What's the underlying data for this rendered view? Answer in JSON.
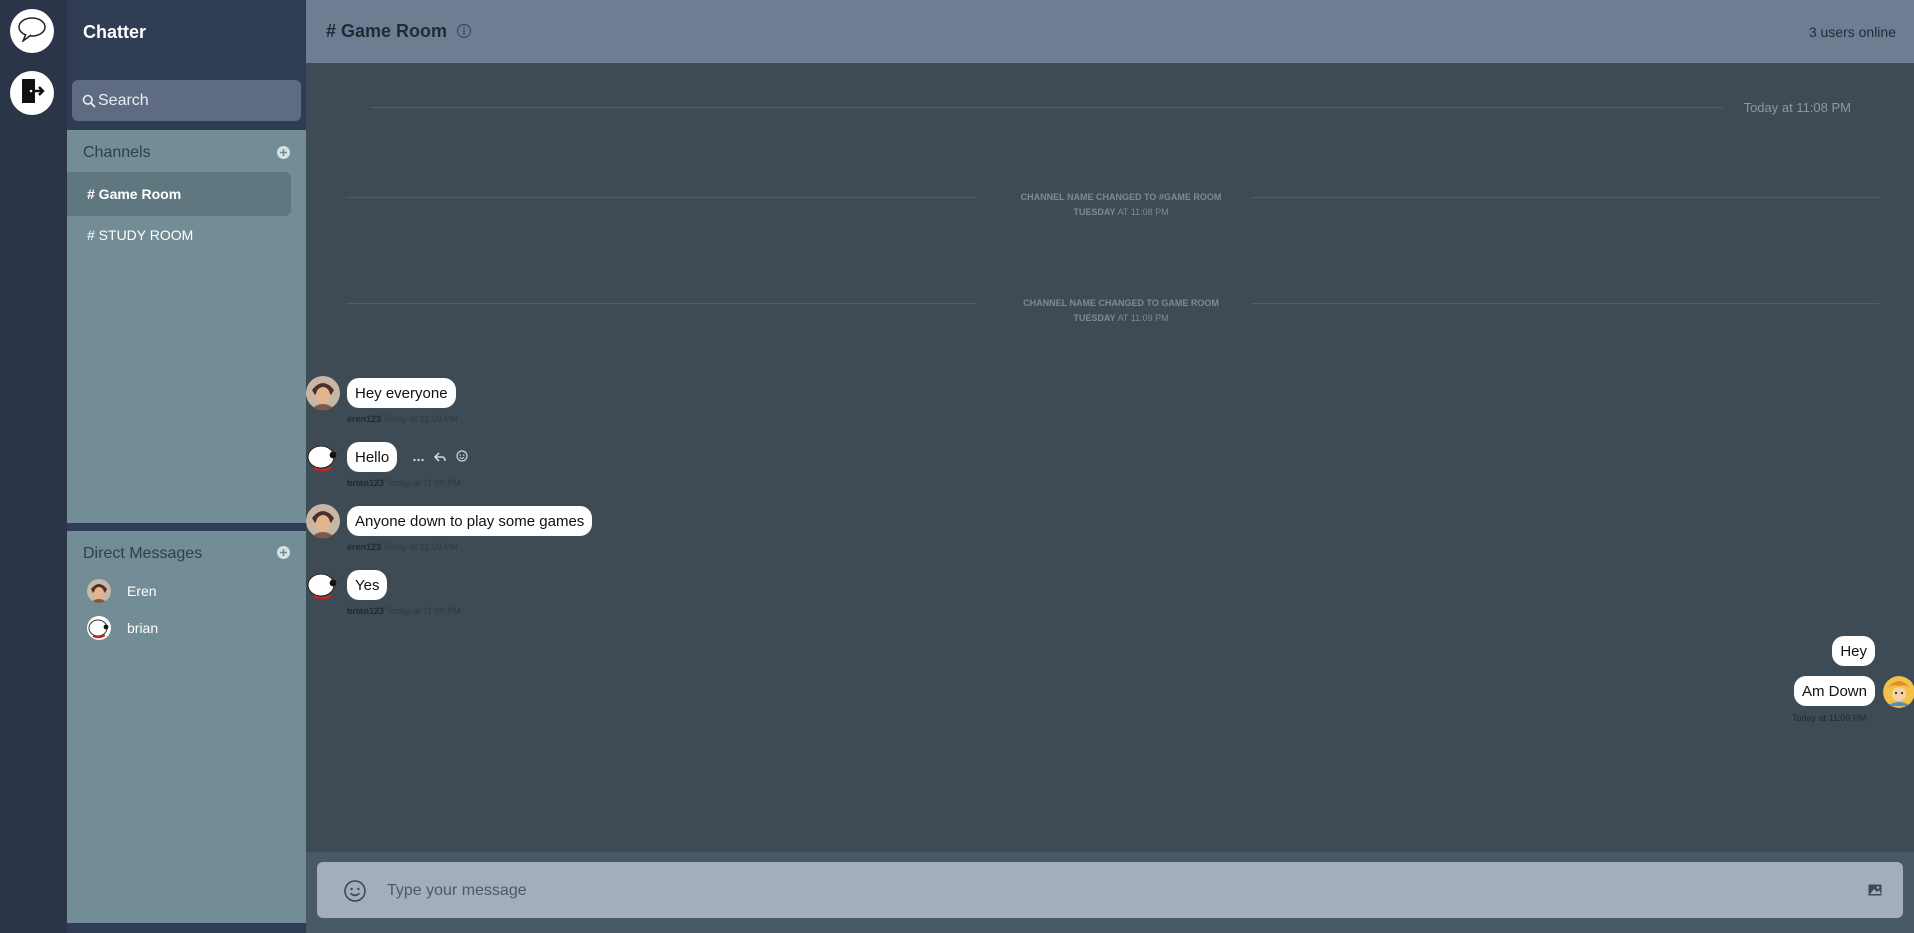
{
  "app": {
    "brand": "Chatter"
  },
  "search": {
    "placeholder": "Search"
  },
  "channels": {
    "title": "Channels",
    "items": [
      {
        "label": "# Game Room",
        "active": true
      },
      {
        "label": "# STUDY ROOM",
        "active": false
      }
    ]
  },
  "dms": {
    "title": "Direct Messages",
    "items": [
      {
        "label": "Eren"
      },
      {
        "label": "brian"
      }
    ]
  },
  "header": {
    "room_title": "# Game Room",
    "users_online": "3 users online"
  },
  "timeline": {
    "today_label": "Today at 11:08 PM",
    "system_messages": [
      {
        "text": "CHANNEL NAME CHANGED TO #GAME ROOM",
        "day": "TUESDAY",
        "time": "AT 11:08 PM"
      },
      {
        "text": "CHANNEL NAME CHANGED TO GAME ROOM",
        "day": "TUESDAY",
        "time": "AT 11:09 PM"
      }
    ],
    "messages": [
      {
        "user": "eren123",
        "time": "Today at 11:09 PM",
        "text": "Hey everyone",
        "avatar": "eren"
      },
      {
        "user": "brian123",
        "time": "Today at 11:09 PM",
        "text": "Hello",
        "avatar": "brian"
      },
      {
        "user": "eren123",
        "time": "Today at 11:09 PM",
        "text": "Anyone down to play some games",
        "avatar": "eren"
      },
      {
        "user": "brian123",
        "time": "Today at 11:09 PM",
        "text": "Yes",
        "avatar": "brian"
      }
    ],
    "own_messages": [
      {
        "text": "Hey"
      },
      {
        "text": "Am Down"
      }
    ],
    "own_time": "Today at 11:09 PM"
  },
  "composer": {
    "placeholder": "Type your message"
  },
  "icons": {
    "rail_top": "speech-bubble-icon",
    "rail_second": "logout-door-icon",
    "search": "search-icon",
    "add": "add-circle-icon",
    "info": "info-icon",
    "emoji": "emoji-icon",
    "image": "image-icon",
    "more": "more-dots-icon",
    "reply": "reply-icon",
    "react": "smiley-icon"
  },
  "colors": {
    "rail": "#2a3548",
    "sidebar_panel": "#728d96",
    "topbar": "#6e7e92",
    "chat_bg": "#3e4b55",
    "composer": "#a4adbc"
  }
}
